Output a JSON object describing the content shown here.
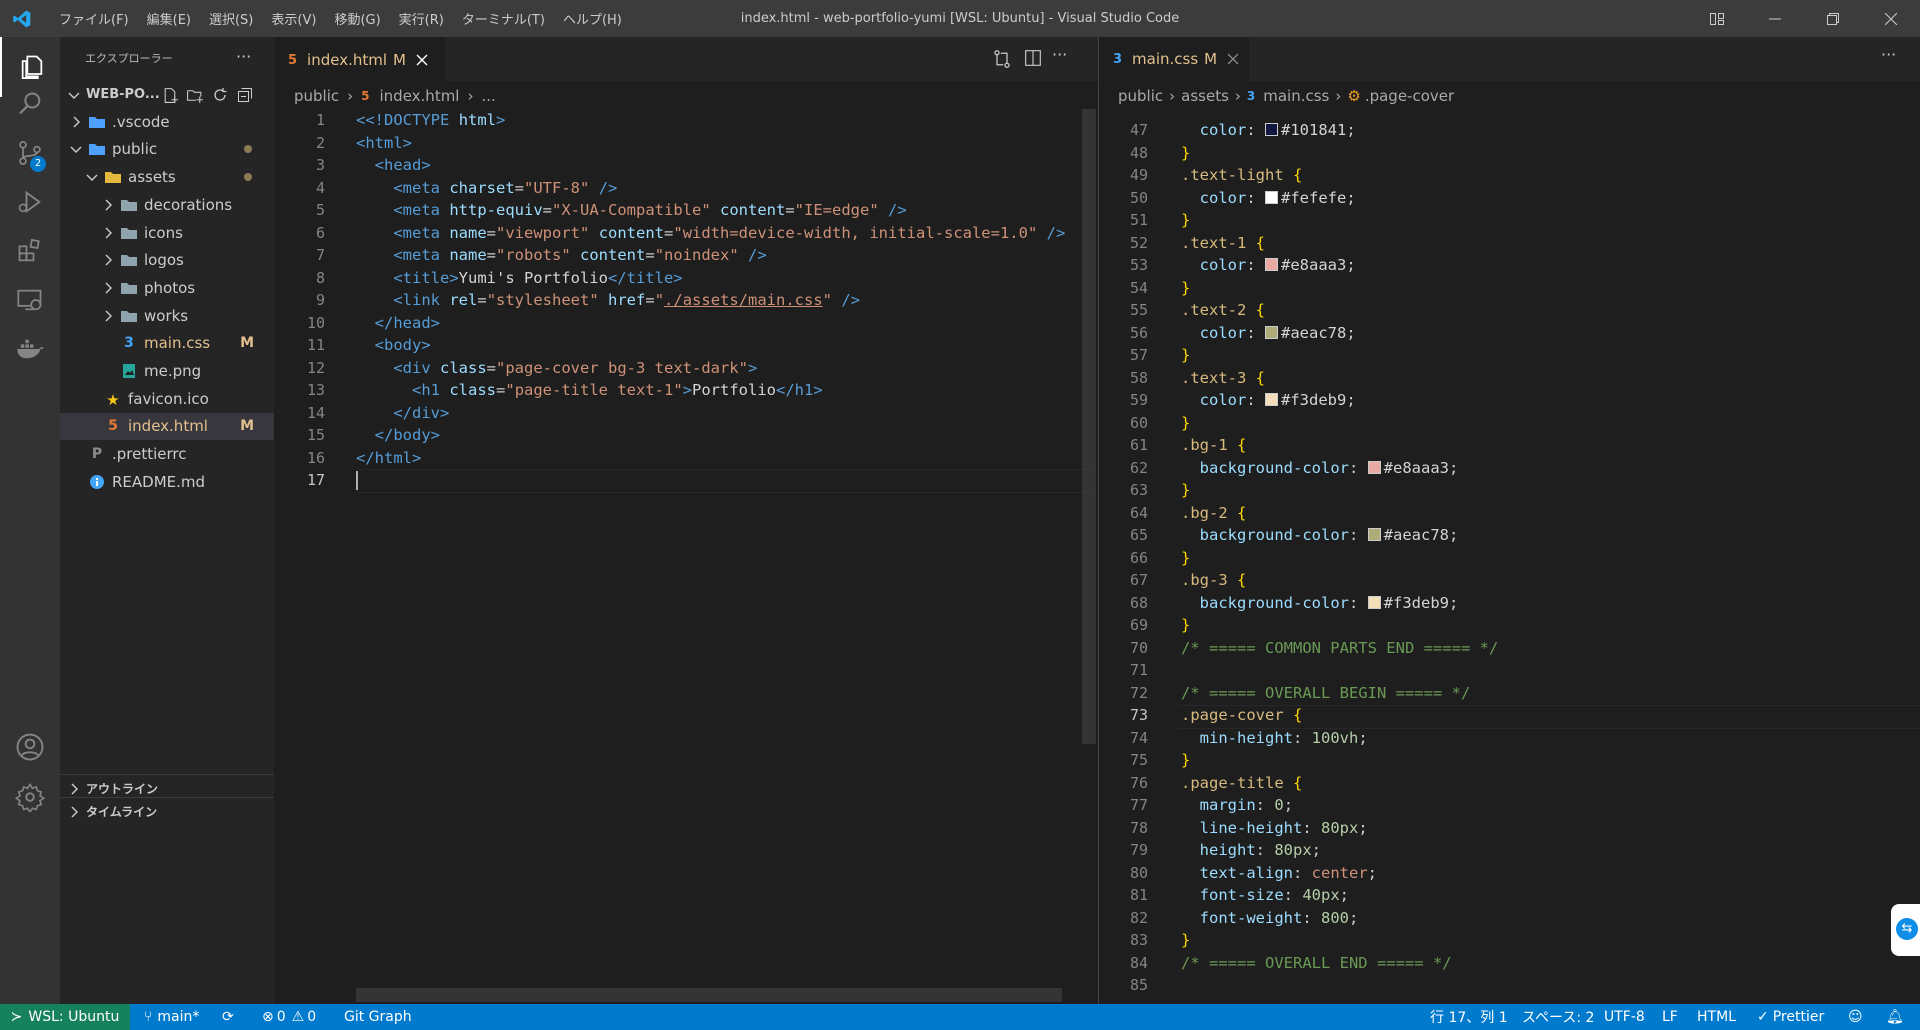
{
  "window": {
    "title": "index.html - web-portfolio-yumi [WSL: Ubuntu] - Visual Studio Code",
    "menus": [
      "ファイル(F)",
      "編集(E)",
      "選択(S)",
      "表示(V)",
      "移動(G)",
      "実行(R)",
      "ターミナル(T)",
      "ヘルプ(H)"
    ]
  },
  "activity": {
    "scm_badge": "2"
  },
  "explorer": {
    "title": "エクスプローラー",
    "root": "WEB-PO...",
    "tree": [
      {
        "label": ".vscode",
        "depth": 1,
        "type": "folder",
        "open": false
      },
      {
        "label": "public",
        "depth": 1,
        "type": "folder",
        "open": true,
        "dot": true
      },
      {
        "label": "assets",
        "depth": 2,
        "type": "folder",
        "open": true,
        "dot": true
      },
      {
        "label": "decorations",
        "depth": 3,
        "type": "folder",
        "open": false
      },
      {
        "label": "icons",
        "depth": 3,
        "type": "folder",
        "open": false
      },
      {
        "label": "logos",
        "depth": 3,
        "type": "folder",
        "open": false
      },
      {
        "label": "photos",
        "depth": 3,
        "type": "folder",
        "open": false
      },
      {
        "label": "works",
        "depth": 3,
        "type": "folder",
        "open": false
      },
      {
        "label": "main.css",
        "depth": 3,
        "type": "css",
        "badge": "M"
      },
      {
        "label": "me.png",
        "depth": 3,
        "type": "png"
      },
      {
        "label": "favicon.ico",
        "depth": 2,
        "type": "ico"
      },
      {
        "label": "index.html",
        "depth": 2,
        "type": "html",
        "badge": "M",
        "selected": true
      },
      {
        "label": ".prettierrc",
        "depth": 1,
        "type": "prettier"
      },
      {
        "label": "README.md",
        "depth": 1,
        "type": "md"
      }
    ],
    "outline": "アウトライン",
    "timeline": "タイムライン"
  },
  "left_editor": {
    "tab": "index.html",
    "tab_badge": "M",
    "breadcrumb": [
      "public",
      "index.html",
      "..."
    ],
    "lines": [
      "1",
      "2",
      "3",
      "4",
      "5",
      "6",
      "7",
      "8",
      "9",
      "10",
      "11",
      "12",
      "13",
      "14",
      "15",
      "16",
      "17"
    ]
  },
  "right_editor": {
    "tab": "main.css",
    "tab_badge": "M",
    "breadcrumb": [
      "public",
      "assets",
      "main.css",
      ".page-cover"
    ],
    "lines": [
      "47",
      "48",
      "49",
      "50",
      "51",
      "52",
      "53",
      "54",
      "55",
      "56",
      "57",
      "58",
      "59",
      "60",
      "61",
      "62",
      "63",
      "64",
      "65",
      "66",
      "67",
      "68",
      "69",
      "70",
      "71",
      "72",
      "73",
      "74",
      "75",
      "76",
      "77",
      "78",
      "79",
      "80",
      "81",
      "82",
      "83",
      "84",
      "85"
    ]
  },
  "code": {
    "html": {
      "doctype": "<!DOCTYPE",
      "doctype_name": "html",
      "title_text": "Yumi's Portfolio",
      "h1_text": "Portfolio",
      "charset": "\"UTF-8\"",
      "http_equiv": "\"X-UA-Compatible\"",
      "edge": "\"IE=edge\"",
      "viewport": "\"viewport\"",
      "viewport_content": "\"width=device-width, initial-scale=1.0\"",
      "robots": "\"robots\"",
      "noindex": "\"noindex\"",
      "stylesheet": "\"stylesheet\"",
      "href": "./assets/main.css",
      "div_class": "\"page-cover bg-3 text-dark\"",
      "h1_class": "\"page-title text-1\""
    },
    "css": {
      "c47": "#101841",
      "s49": ".text-light",
      "c50": "#fefefe",
      "s52": ".text-1",
      "c53": "#e8aaa3",
      "s55": ".text-2",
      "c56": "#aeac78",
      "s58": ".text-3",
      "c59": "#f3deb9",
      "s61": ".bg-1",
      "c62": "#e8aaa3",
      "s64": ".bg-2",
      "c65": "#aeac78",
      "s67": ".bg-3",
      "c68": "#f3deb9",
      "com70": "/* ===== COMMON PARTS END ===== */",
      "com72": "/* ===== OVERALL BEGIN ===== */",
      "s73": ".page-cover",
      "v74": "100vh",
      "s76": ".page-title",
      "v77": "0",
      "v78": "80px",
      "v79": "80px",
      "v80": "center",
      "v81": "40px",
      "v82": "800",
      "com84": "/* ===== OVERALL END ===== */"
    }
  },
  "statusbar": {
    "remote": "WSL: Ubuntu",
    "branch": "main*",
    "errors": "0",
    "warnings": "0",
    "gitgraph": "Git Graph",
    "position": "行 17、列 1",
    "spaces": "スペース: 2",
    "encoding": "UTF-8",
    "eol": "LF",
    "language": "HTML",
    "prettier": "Prettier"
  },
  "colors": {
    "accent": "#007acc",
    "remote": "#16825d",
    "modified": "#e2c08d"
  }
}
